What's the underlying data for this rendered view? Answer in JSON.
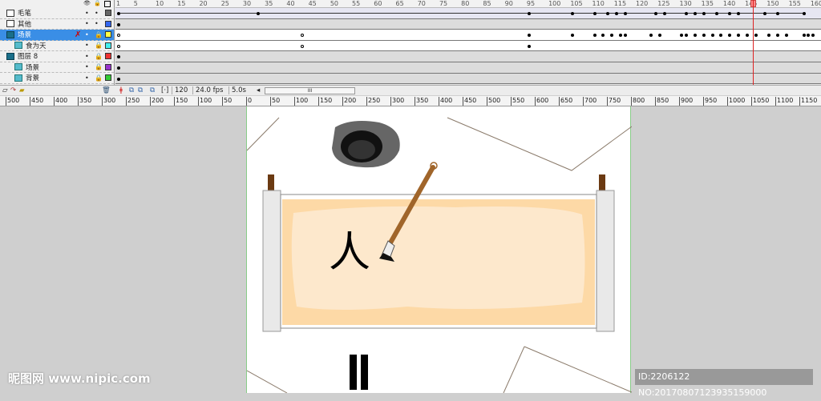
{
  "timeline": {
    "layers": [
      {
        "name": "毛笔",
        "type": "folder",
        "color": "#666666",
        "selected": false,
        "sub": false,
        "lock": "•"
      },
      {
        "name": "其他",
        "type": "folder",
        "color": "#3366ee",
        "selected": false,
        "sub": false,
        "lock": "•"
      },
      {
        "name": "场景",
        "type": "mask",
        "color": "#ffff44",
        "selected": true,
        "sub": false,
        "lock": "🔒"
      },
      {
        "name": "食为天",
        "type": "masked",
        "color": "#44eeee",
        "selected": false,
        "sub": true,
        "lock": "🔒"
      },
      {
        "name": "图层 8",
        "type": "mask",
        "color": "#ee3333",
        "selected": false,
        "sub": false,
        "lock": "🔒"
      },
      {
        "name": "场景",
        "type": "masked",
        "color": "#9933cc",
        "selected": false,
        "sub": true,
        "lock": "🔒"
      },
      {
        "name": "背景",
        "type": "masked",
        "color": "#33cc33",
        "selected": false,
        "sub": true,
        "lock": "🔒"
      }
    ],
    "frame_ticks": [
      1,
      5,
      10,
      15,
      20,
      25,
      30,
      35,
      40,
      45,
      50,
      55,
      60,
      65,
      70,
      75,
      80,
      85,
      90,
      95,
      100,
      105,
      110,
      115,
      120,
      125,
      130,
      135,
      140,
      145,
      150,
      155,
      160
    ],
    "keyframes": [
      [
        1,
        33,
        95,
        105,
        110,
        113,
        115,
        117,
        124,
        126,
        131,
        133,
        135,
        138,
        141,
        143,
        149,
        152,
        158
      ],
      [
        1
      ],
      [
        1,
        43,
        95,
        105,
        110,
        112,
        114,
        116,
        117,
        123,
        125,
        130,
        131,
        133,
        135,
        137,
        139,
        141,
        143,
        145,
        147,
        150,
        152,
        154,
        158,
        159,
        160
      ],
      [
        1,
        43,
        95
      ],
      [
        1
      ],
      [
        1
      ],
      [
        1
      ]
    ],
    "current_frame": "120",
    "fps": "24.0 fps",
    "time": "5.0s",
    "scroll_grip": "III"
  },
  "ruler": {
    "ticks": [
      -500,
      -450,
      -400,
      -350,
      -300,
      -250,
      -200,
      -150,
      -100,
      -50,
      0,
      50,
      100,
      150,
      200,
      250,
      300,
      350,
      400,
      450,
      500,
      550,
      600,
      650,
      700,
      750,
      800,
      850,
      900,
      950,
      1000,
      1050,
      1100,
      1150
    ]
  },
  "stage": {
    "character": "人"
  },
  "watermark": {
    "logo": "昵图网",
    "site": "www.nipic.com",
    "id": "ID:2206122 NO:20170807123935159000"
  }
}
